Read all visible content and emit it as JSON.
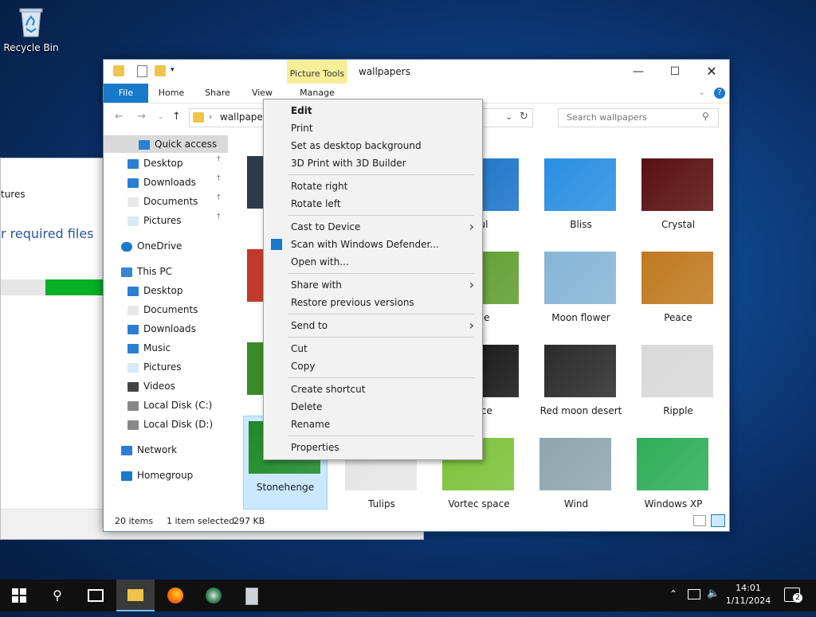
{
  "desktop": {
    "recycle_bin": "Recycle Bin"
  },
  "installer": {
    "text1": "tures",
    "text2": "r required files",
    "progress_fraction": 0.57
  },
  "explorer": {
    "picture_tools": "Picture Tools",
    "title": "wallpapers",
    "ribbon_tabs": [
      "File",
      "Home",
      "Share",
      "View",
      "Manage"
    ],
    "address": "wallpapers",
    "search_placeholder": "Search wallpapers",
    "nav": [
      {
        "label": "Quick access",
        "icon": "star-icon"
      },
      {
        "label": "Desktop",
        "icon": "desktop-folder-icon"
      },
      {
        "label": "Downloads",
        "icon": "download-arrow-icon"
      },
      {
        "label": "Documents",
        "icon": "document-icon"
      },
      {
        "label": "Pictures",
        "icon": "pictures-icon"
      },
      {
        "label": "OneDrive",
        "icon": "cloud-icon"
      },
      {
        "label": "This PC",
        "icon": "computer-icon"
      },
      {
        "label": "Desktop",
        "icon": "desktop-folder-icon"
      },
      {
        "label": "Documents",
        "icon": "document-icon"
      },
      {
        "label": "Downloads",
        "icon": "download-arrow-icon"
      },
      {
        "label": "Music",
        "icon": "music-note-icon"
      },
      {
        "label": "Pictures",
        "icon": "pictures-icon"
      },
      {
        "label": "Videos",
        "icon": "film-icon"
      },
      {
        "label": "Local Disk (C:)",
        "icon": "drive-icon"
      },
      {
        "label": "Local Disk (D:)",
        "icon": "drive-icon"
      },
      {
        "label": "Network",
        "icon": "network-icon"
      },
      {
        "label": "Homegroup",
        "icon": "homegroup-icon"
      }
    ],
    "files": [
      {
        "name": "ul",
        "color": "#1b73c9"
      },
      {
        "name": "Bliss",
        "color": "#2a8fe3"
      },
      {
        "name": "Crystal",
        "color": "#5a1010"
      },
      {
        "name": "ne",
        "color": "#5f9e2f"
      },
      {
        "name": "Moon flower",
        "color": "#86b6d6"
      },
      {
        "name": "Peace",
        "color": "#c07a20"
      },
      {
        "name": "nce",
        "color": "#151515"
      },
      {
        "name": "Red moon desert",
        "color": "#2b2b2b"
      },
      {
        "name": "Ripple",
        "color": "#d9d9d9"
      },
      {
        "name": "Stonehenge",
        "color": "#1e8a28"
      },
      {
        "name": "Tulips",
        "color": "#e5e5e5"
      },
      {
        "name": "Vortec space",
        "color": "#7cc23a"
      },
      {
        "name": "Wind",
        "color": "#8fa6ad"
      },
      {
        "name": "Windows XP",
        "color": "#2fae5a"
      }
    ],
    "status": {
      "count": "20 items",
      "selected": "1 item selected",
      "size": "297 KB"
    }
  },
  "context_menu": {
    "items": [
      "Edit",
      "Print",
      "Set as desktop background",
      "3D Print with 3D Builder",
      "Rotate right",
      "Rotate left",
      "Cast to Device",
      "Scan with Windows Defender...",
      "Open with...",
      "Share with",
      "Restore previous versions",
      "Send to",
      "Cut",
      "Copy",
      "Create shortcut",
      "Delete",
      "Rename",
      "Properties"
    ]
  },
  "taskbar": {
    "time": "14:01",
    "date": "1/11/2024",
    "notifications": "2"
  }
}
